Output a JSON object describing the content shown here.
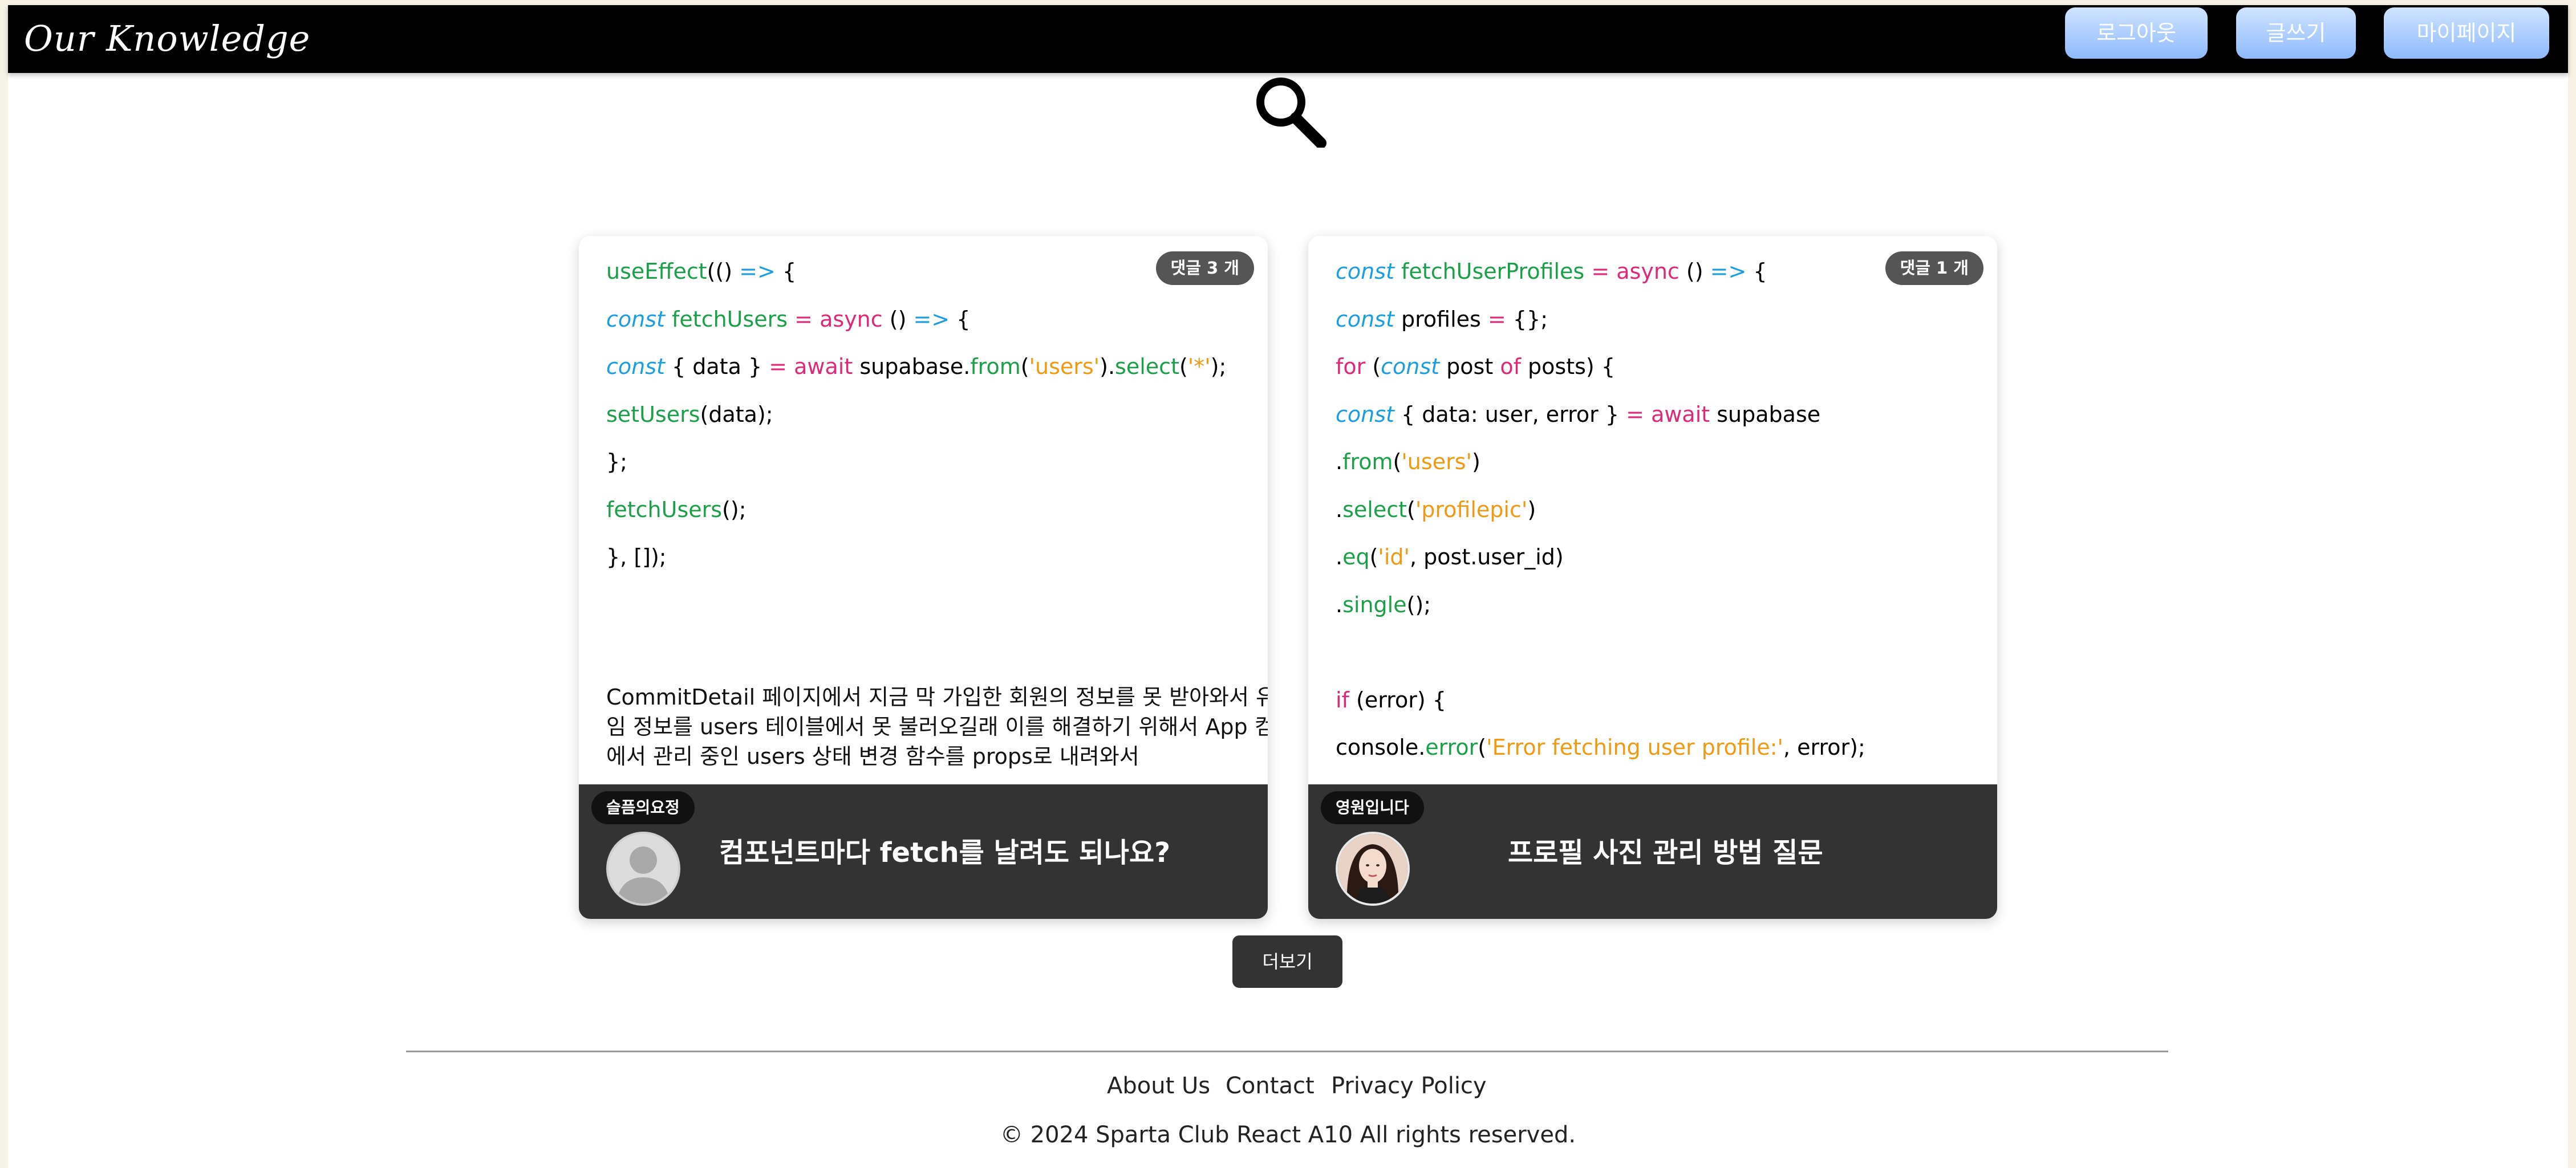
{
  "header": {
    "logo": "Our Knowledge",
    "buttons": {
      "logout": "로그아웃",
      "write": "글쓰기",
      "mypage": "마이페이지"
    },
    "button_color": "#8fbaff"
  },
  "search": {
    "icon": "search-icon"
  },
  "posts": [
    {
      "comment_badge": "댓글 3 개",
      "code_lines": [
        "useEffect(() => {",
        "const fetchUsers = async () => {",
        "const { data } = await supabase.from('users').select('*');",
        "setUsers(data);",
        "};",
        "fetchUsers();",
        "}, []);"
      ],
      "description_lines": [
        "CommitDetail 페이지에서 지금 막 가입한 회원의 정보를 못 받아와서 유저 닉",
        "임 정보를 users 테이블에서 못 불러오길래 이를 해결하기 위해서 App 컴포넌",
        "에서 관리 중인 users 상태 변경 함수를 props로 내려와서"
      ],
      "nickname": "슬픔의요정",
      "title": "컴포넌트마다 fetch를 날려도 되나요?"
    },
    {
      "comment_badge": "댓글 1 개",
      "code_lines": [
        "const fetchUserProfiles = async () => {",
        "const profiles = {};",
        "for (const post of posts) {",
        "const { data: user, error } = await supabase",
        ".from('users')",
        ".select('profilepic')",
        ".eq('id', post.user_id)",
        ".single();",
        "",
        "if (error) {",
        "console.error('Error fetching user profile:', error);"
      ],
      "nickname": "영원입니다",
      "title": "프로필 사진 관리 방법 질문"
    }
  ],
  "more_button": "더보기",
  "footer": {
    "links": [
      "About Us",
      "Contact",
      "Privacy Policy"
    ],
    "copyright": "© 2024 Sparta Club React A10 All rights reserved."
  },
  "colors": {
    "page_bg": "#f6f2e6",
    "header_bg": "#000000",
    "card_footer_bg": "#333333",
    "keyword": "#e0287a",
    "function": "#1ba049",
    "string": "#f09a12",
    "const": "#1a9ee0"
  }
}
